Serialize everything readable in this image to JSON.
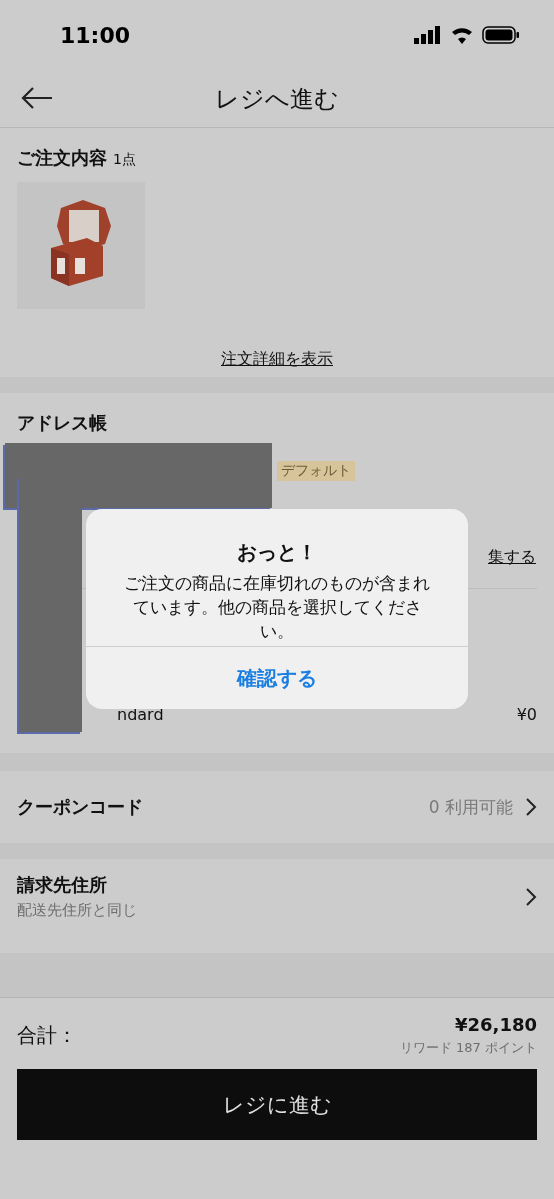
{
  "status_bar": {
    "time": "11:00"
  },
  "header": {
    "title": "レジへ進む"
  },
  "order": {
    "title": "ご注文内容",
    "count": "1点",
    "details_link": "注文詳細を表示"
  },
  "address_book": {
    "title": "アドレス帳",
    "default_tag": "デフォルト",
    "edit_link": "集する",
    "shipping": {
      "label": "ndard",
      "price": "¥0"
    }
  },
  "coupon": {
    "label": "クーポンコード",
    "value": "0 利用可能"
  },
  "billing": {
    "title": "請求先住所",
    "subtitle": "配送先住所と同じ"
  },
  "footer": {
    "total_label": "合計：",
    "total": "¥26,180",
    "rewards": "リワード 187 ポイント",
    "checkout_button": "レジに進む"
  },
  "alert": {
    "title": "おっと！",
    "message": "ご注文の商品に在庫切れのものが含まれています。他の商品を選択してください。",
    "button": "確認する"
  }
}
